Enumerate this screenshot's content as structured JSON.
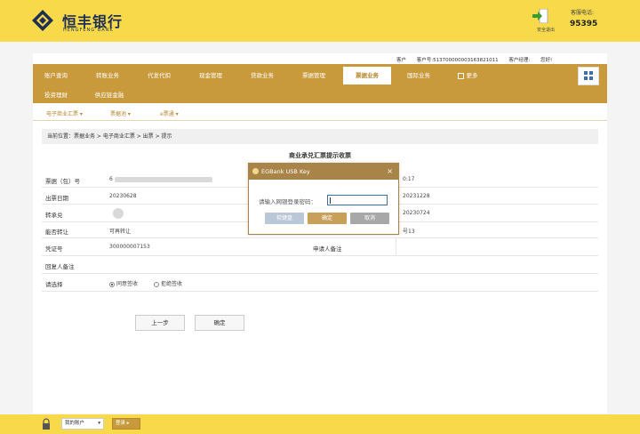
{
  "header": {
    "bank_name": "恒丰银行",
    "bank_name_en": "HENGFENG BANK",
    "exit_label": "安全退出",
    "hotline_label": "客服电话:",
    "hotline_number": "95395"
  },
  "userbar": {
    "items": [
      "客户",
      "客户号:513700000003163821011",
      "客户经理:",
      "您好!"
    ]
  },
  "nav": {
    "row1": [
      "账户查询",
      "转账业务",
      "代发代扣",
      "现金管理",
      "贷款业务",
      "票据管理",
      "票据业务",
      "国际业务",
      "更多"
    ],
    "row2": [
      "投资理财",
      "供应链金融"
    ],
    "active": "票据业务"
  },
  "subnav": [
    "电子商业汇票",
    "票据池",
    "e票通"
  ],
  "breadcrumb": "当前位置：票据业务 > 电子商业汇票 > 出票 > 提示",
  "form": {
    "title": "商业承兑汇票提示收票",
    "rows": [
      {
        "label": "票据（包）号",
        "value": "6",
        "right_value": "0:17"
      },
      {
        "label": "出票日期",
        "value": "20230628",
        "right_value": "20231228"
      },
      {
        "label": "转承兑",
        "value": "",
        "right_value": "20230724"
      },
      {
        "label": "能否转让",
        "value": "可再转让",
        "right_value": "号13"
      },
      {
        "label": "凭证号",
        "value": "300000007153",
        "right_label": "申请人备注"
      },
      {
        "label": "回复人备注",
        "value": ""
      },
      {
        "label": "请选择",
        "options": [
          "同意签收",
          "拒绝签收"
        ],
        "selected": 0
      }
    ],
    "back_button": "上一步",
    "confirm_button": "确定"
  },
  "dialog": {
    "title": "EGBank USB Key",
    "close": "×",
    "prompt": "请输入网银登录密码：",
    "password_value": "",
    "buttons": [
      "软键盘",
      "确定",
      "取消"
    ],
    "button_colors": [
      "#b9c7d6",
      "#c8a05a",
      "#a8a8a8"
    ]
  },
  "footer": {
    "account_select": "我的账户",
    "account_button": "登录"
  },
  "colors": {
    "brand_yellow": "#f7d94a",
    "nav_gold": "#c89a3c",
    "dialog_header": "#a98448"
  }
}
